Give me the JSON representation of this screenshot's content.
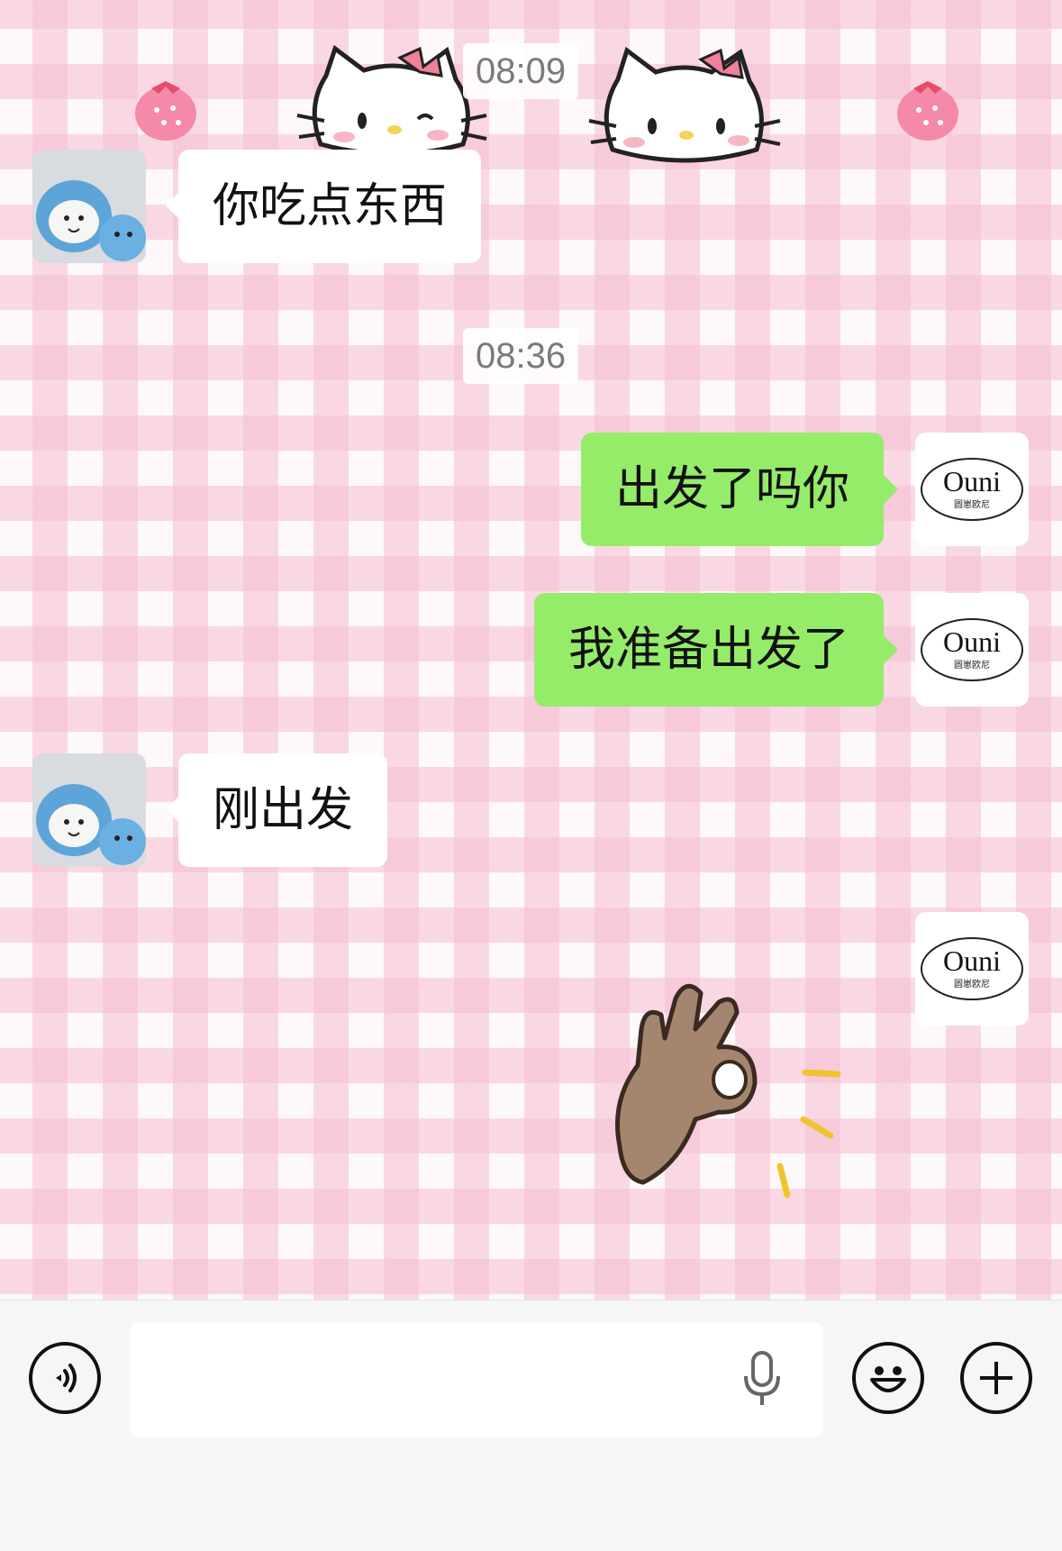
{
  "chat": {
    "timestamps": [
      "08:09",
      "08:36"
    ],
    "messages": [
      {
        "side": "in",
        "text": "你吃点东西"
      },
      {
        "side": "out",
        "text": "出发了吗你"
      },
      {
        "side": "out",
        "text": "我准备出发了"
      },
      {
        "side": "in",
        "text": "刚出发"
      }
    ],
    "self_avatar": {
      "logo_main": "Ouni",
      "logo_sub": "圆崽欧尼"
    }
  },
  "input_bar": {
    "text_value": "",
    "icons": [
      "voice-toggle-icon",
      "microphone-icon",
      "emoji-icon",
      "plus-icon"
    ]
  },
  "colors": {
    "outgoing_bubble": "#95ec69",
    "incoming_bubble": "#ffffff",
    "check_pink": "#f6bed2"
  }
}
